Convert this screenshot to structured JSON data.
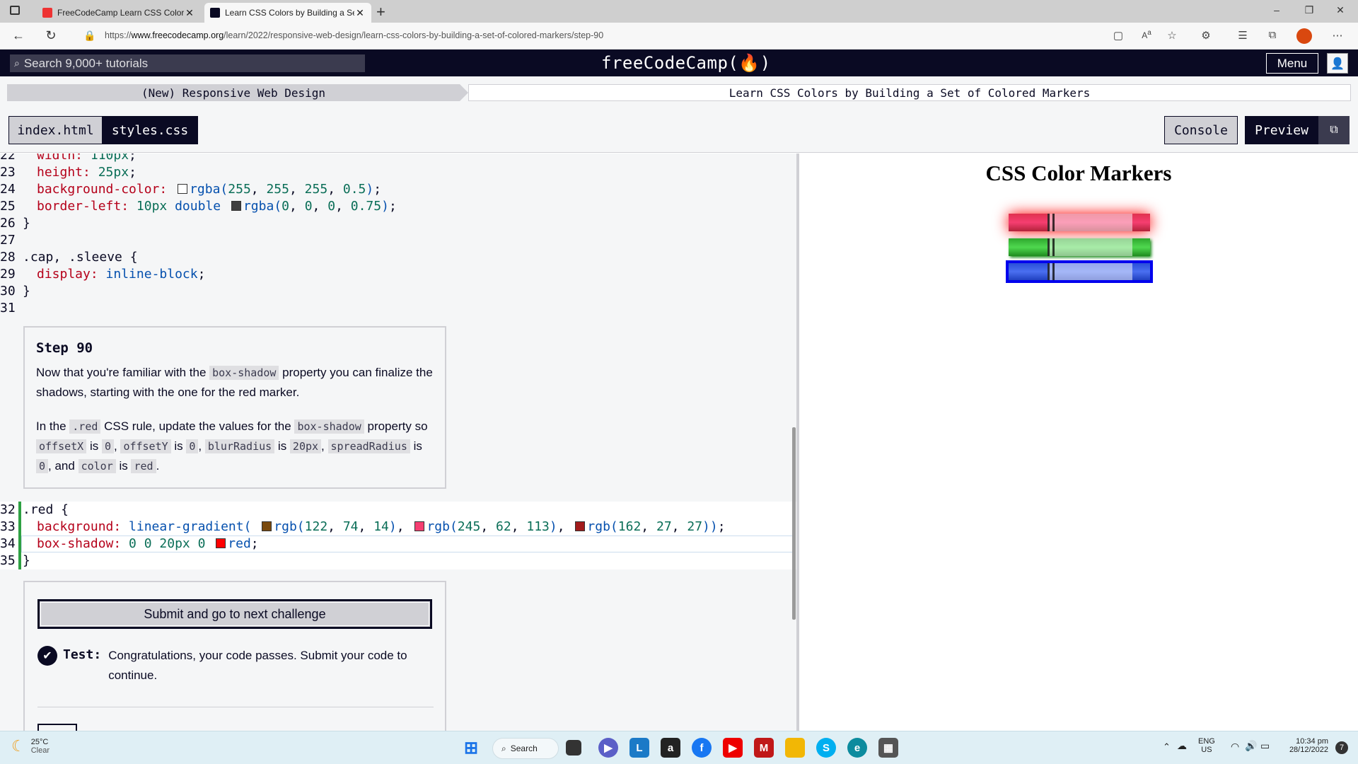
{
  "browser": {
    "tabs": [
      {
        "title": "FreeCodeCamp Learn CSS Colors",
        "active": false
      },
      {
        "title": "Learn CSS Colors by Building a Set",
        "active": true
      }
    ],
    "url_prefix": "https://",
    "url_domain": "www.freecodecamp.org",
    "url_path": "/learn/2022/responsive-web-design/learn-css-colors-by-building-a-set-of-colored-markers/step-90"
  },
  "header": {
    "search_placeholder": "Search 9,000+ tutorials",
    "logo": "freeCodeCamp(🔥)",
    "menu_label": "Menu"
  },
  "breadcrumb": {
    "superblock": "(New) Responsive Web Design",
    "block": "Learn CSS Colors by Building a Set of Colored Markers"
  },
  "toolbar": {
    "files": [
      "index.html",
      "styles.css"
    ],
    "active_file": "styles.css",
    "console_label": "Console",
    "preview_label": "Preview"
  },
  "editor": {
    "top_lines": [
      {
        "n": "22",
        "text": "  width: 110px;"
      },
      {
        "n": "23",
        "text": "  height: 25px;"
      },
      {
        "n": "24",
        "text": "  background-color: rgba(255, 255, 255, 0.5);"
      },
      {
        "n": "25",
        "text": "  border-left: 10px double rgba(0, 0, 0, 0.75);"
      },
      {
        "n": "26",
        "text": "}"
      },
      {
        "n": "27",
        "text": ""
      },
      {
        "n": "28",
        "text": ".cap, .sleeve {"
      },
      {
        "n": "29",
        "text": "  display: inline-block;"
      },
      {
        "n": "30",
        "text": "}"
      },
      {
        "n": "31",
        "text": ""
      }
    ],
    "bottom_lines": [
      {
        "n": "32",
        "text": ".red {"
      },
      {
        "n": "33",
        "text": "  background: linear-gradient(rgb(122, 74, 14), rgb(245, 62, 113), rgb(162, 27, 27));"
      },
      {
        "n": "34",
        "text": "  box-shadow: 0 0 20px 0 red;"
      },
      {
        "n": "35",
        "text": "}"
      }
    ],
    "swatches": {
      "white_half": "#ffffff",
      "black_75": "#404040",
      "brown": "#7a4a0e",
      "pink": "#f53e71",
      "darkred": "#a21b1b",
      "red": "#ff0000"
    }
  },
  "step": {
    "title": "Step 90",
    "p1_before": "Now that you're familiar with the ",
    "p1_code": "box-shadow",
    "p1_after": " property you can finalize the shadows, starting with the one for the red marker.",
    "p2": {
      "t1": "In the ",
      "c1": ".red",
      "t2": " CSS rule, update the values for the ",
      "c2": "box-shadow",
      "t3": " property so ",
      "c3": "offsetX",
      "t4": " is ",
      "c4": "0",
      "t5": ", ",
      "c5": "offsetY",
      "t6": " is ",
      "c6": "0",
      "t7": ", ",
      "c7": "blurRadius",
      "t8": " is ",
      "c8": "20px",
      "t9": ", ",
      "c9": "spreadRadius",
      "t10": " is ",
      "c10": "0",
      "t11": ", and ",
      "c11": "color",
      "t12": " is ",
      "c12": "red",
      "t13": "."
    }
  },
  "submit": {
    "button_label": "Submit and go to next challenge",
    "test_label": "Test:",
    "test_message": "Congratulations, your code passes. Submit your code to continue."
  },
  "preview": {
    "title": "CSS Color Markers",
    "markers": [
      {
        "name": "red",
        "cap": "#e0324f",
        "sleeve": "#f0a2b4",
        "shadow": "#ff0000"
      },
      {
        "name": "green",
        "cap": "#27b427",
        "sleeve": "#a6e3a6",
        "shadow": "#1a8a1a"
      },
      {
        "name": "blue",
        "cap": "#2a4fd8",
        "sleeve": "#a6b6f0",
        "shadow": "#0000ff"
      }
    ]
  },
  "taskbar": {
    "temperature": "25°C",
    "condition": "Clear",
    "search_label": "Search",
    "lang_1": "ENG",
    "lang_2": "US",
    "time": "10:34 pm",
    "date": "28/12/2022",
    "notifications": "7"
  }
}
